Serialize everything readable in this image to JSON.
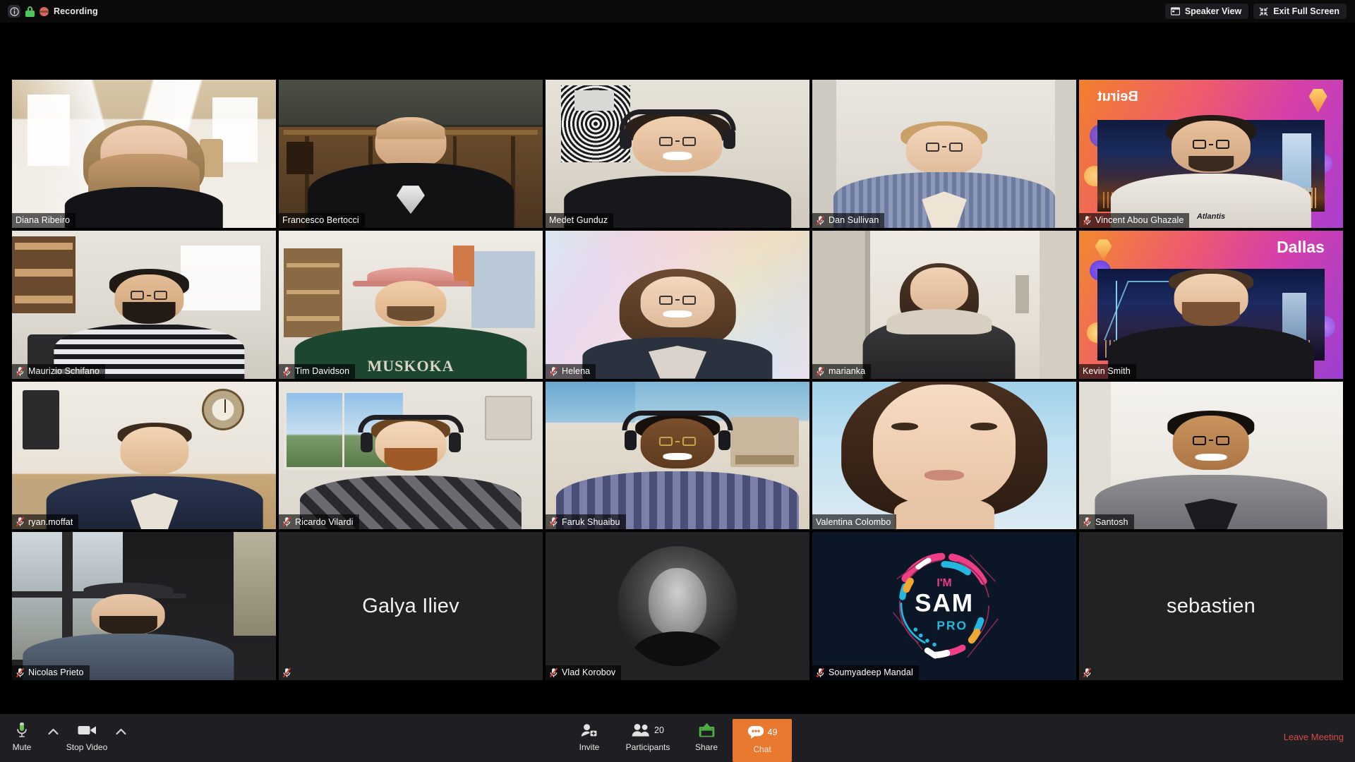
{
  "topbar": {
    "info_icon": "info-icon",
    "lock_icon": "lock-icon",
    "recording_icon": "recording-indicator-icon",
    "recording_label": "Recording",
    "speaker_view_label": "Speaker View",
    "speaker_view_icon": "speaker-view-icon",
    "exit_full_screen_label": "Exit Full Screen",
    "exit_full_screen_icon": "exit-fullscreen-icon"
  },
  "grid": {
    "columns": 5,
    "rows": 4,
    "speaking_border_color": "#d8e05c",
    "tiles": [
      {
        "name": "Diana Ribeiro",
        "muted": false,
        "speaking": false,
        "mode": "video"
      },
      {
        "name": "Francesco Bertocci",
        "muted": false,
        "speaking": false,
        "mode": "video"
      },
      {
        "name": "Medet Gunduz",
        "muted": false,
        "speaking": true,
        "mode": "video"
      },
      {
        "name": "Dan Sullivan",
        "muted": true,
        "speaking": false,
        "mode": "video"
      },
      {
        "name": "Vincent Abou Ghazale",
        "muted": true,
        "speaking": false,
        "mode": "video"
      },
      {
        "name": "Maurizio Schifano",
        "muted": true,
        "speaking": false,
        "mode": "video"
      },
      {
        "name": "Tim Davidson",
        "muted": true,
        "speaking": false,
        "mode": "video"
      },
      {
        "name": "Helena",
        "muted": true,
        "speaking": false,
        "mode": "video"
      },
      {
        "name": "marianka",
        "muted": true,
        "speaking": false,
        "mode": "video"
      },
      {
        "name": "Kevin Smith",
        "muted": false,
        "speaking": false,
        "mode": "video"
      },
      {
        "name": "ryan.moffat",
        "muted": true,
        "speaking": false,
        "mode": "video"
      },
      {
        "name": "Ricardo Vilardi",
        "muted": true,
        "speaking": false,
        "mode": "video"
      },
      {
        "name": "Faruk Shuaibu",
        "muted": true,
        "speaking": false,
        "mode": "video"
      },
      {
        "name": "Valentina Colombo",
        "muted": false,
        "speaking": false,
        "mode": "video"
      },
      {
        "name": "Santosh",
        "muted": true,
        "speaking": false,
        "mode": "video"
      },
      {
        "name": "Nicolas Prieto",
        "muted": true,
        "speaking": false,
        "mode": "video"
      },
      {
        "name": "Galya Iliev",
        "muted": true,
        "speaking": false,
        "mode": "name-only",
        "label_hidden": true
      },
      {
        "name": "Vlad Korobov",
        "muted": true,
        "speaking": false,
        "mode": "avatar"
      },
      {
        "name": "Soumyadeep Mandal",
        "muted": true,
        "speaking": false,
        "mode": "logo",
        "logo_text_1": "I'M",
        "logo_text_2": "SAM",
        "logo_text_3": "PRO"
      },
      {
        "name": "sebastien",
        "muted": true,
        "speaking": false,
        "mode": "name-only",
        "label_hidden": true
      }
    ],
    "virtual_backgrounds": {
      "vincent": "Beirut",
      "kevin": "Dallas"
    }
  },
  "toolbar": {
    "mute_label": "Mute",
    "mute_icon": "microphone-icon",
    "audio_options_icon": "chevron-up-icon",
    "stop_video_label": "Stop Video",
    "stop_video_icon": "video-camera-icon",
    "video_options_icon": "chevron-up-icon",
    "invite_label": "Invite",
    "invite_icon": "add-person-icon",
    "participants_label": "Participants",
    "participants_icon": "people-icon",
    "participants_count": "20",
    "share_label": "Share",
    "share_icon": "share-screen-icon",
    "chat_label": "Chat",
    "chat_icon": "chat-bubble-icon",
    "chat_count": "49",
    "chat_active_color": "#e8792e",
    "leave_label": "Leave Meeting",
    "leave_color": "#d64b43"
  }
}
